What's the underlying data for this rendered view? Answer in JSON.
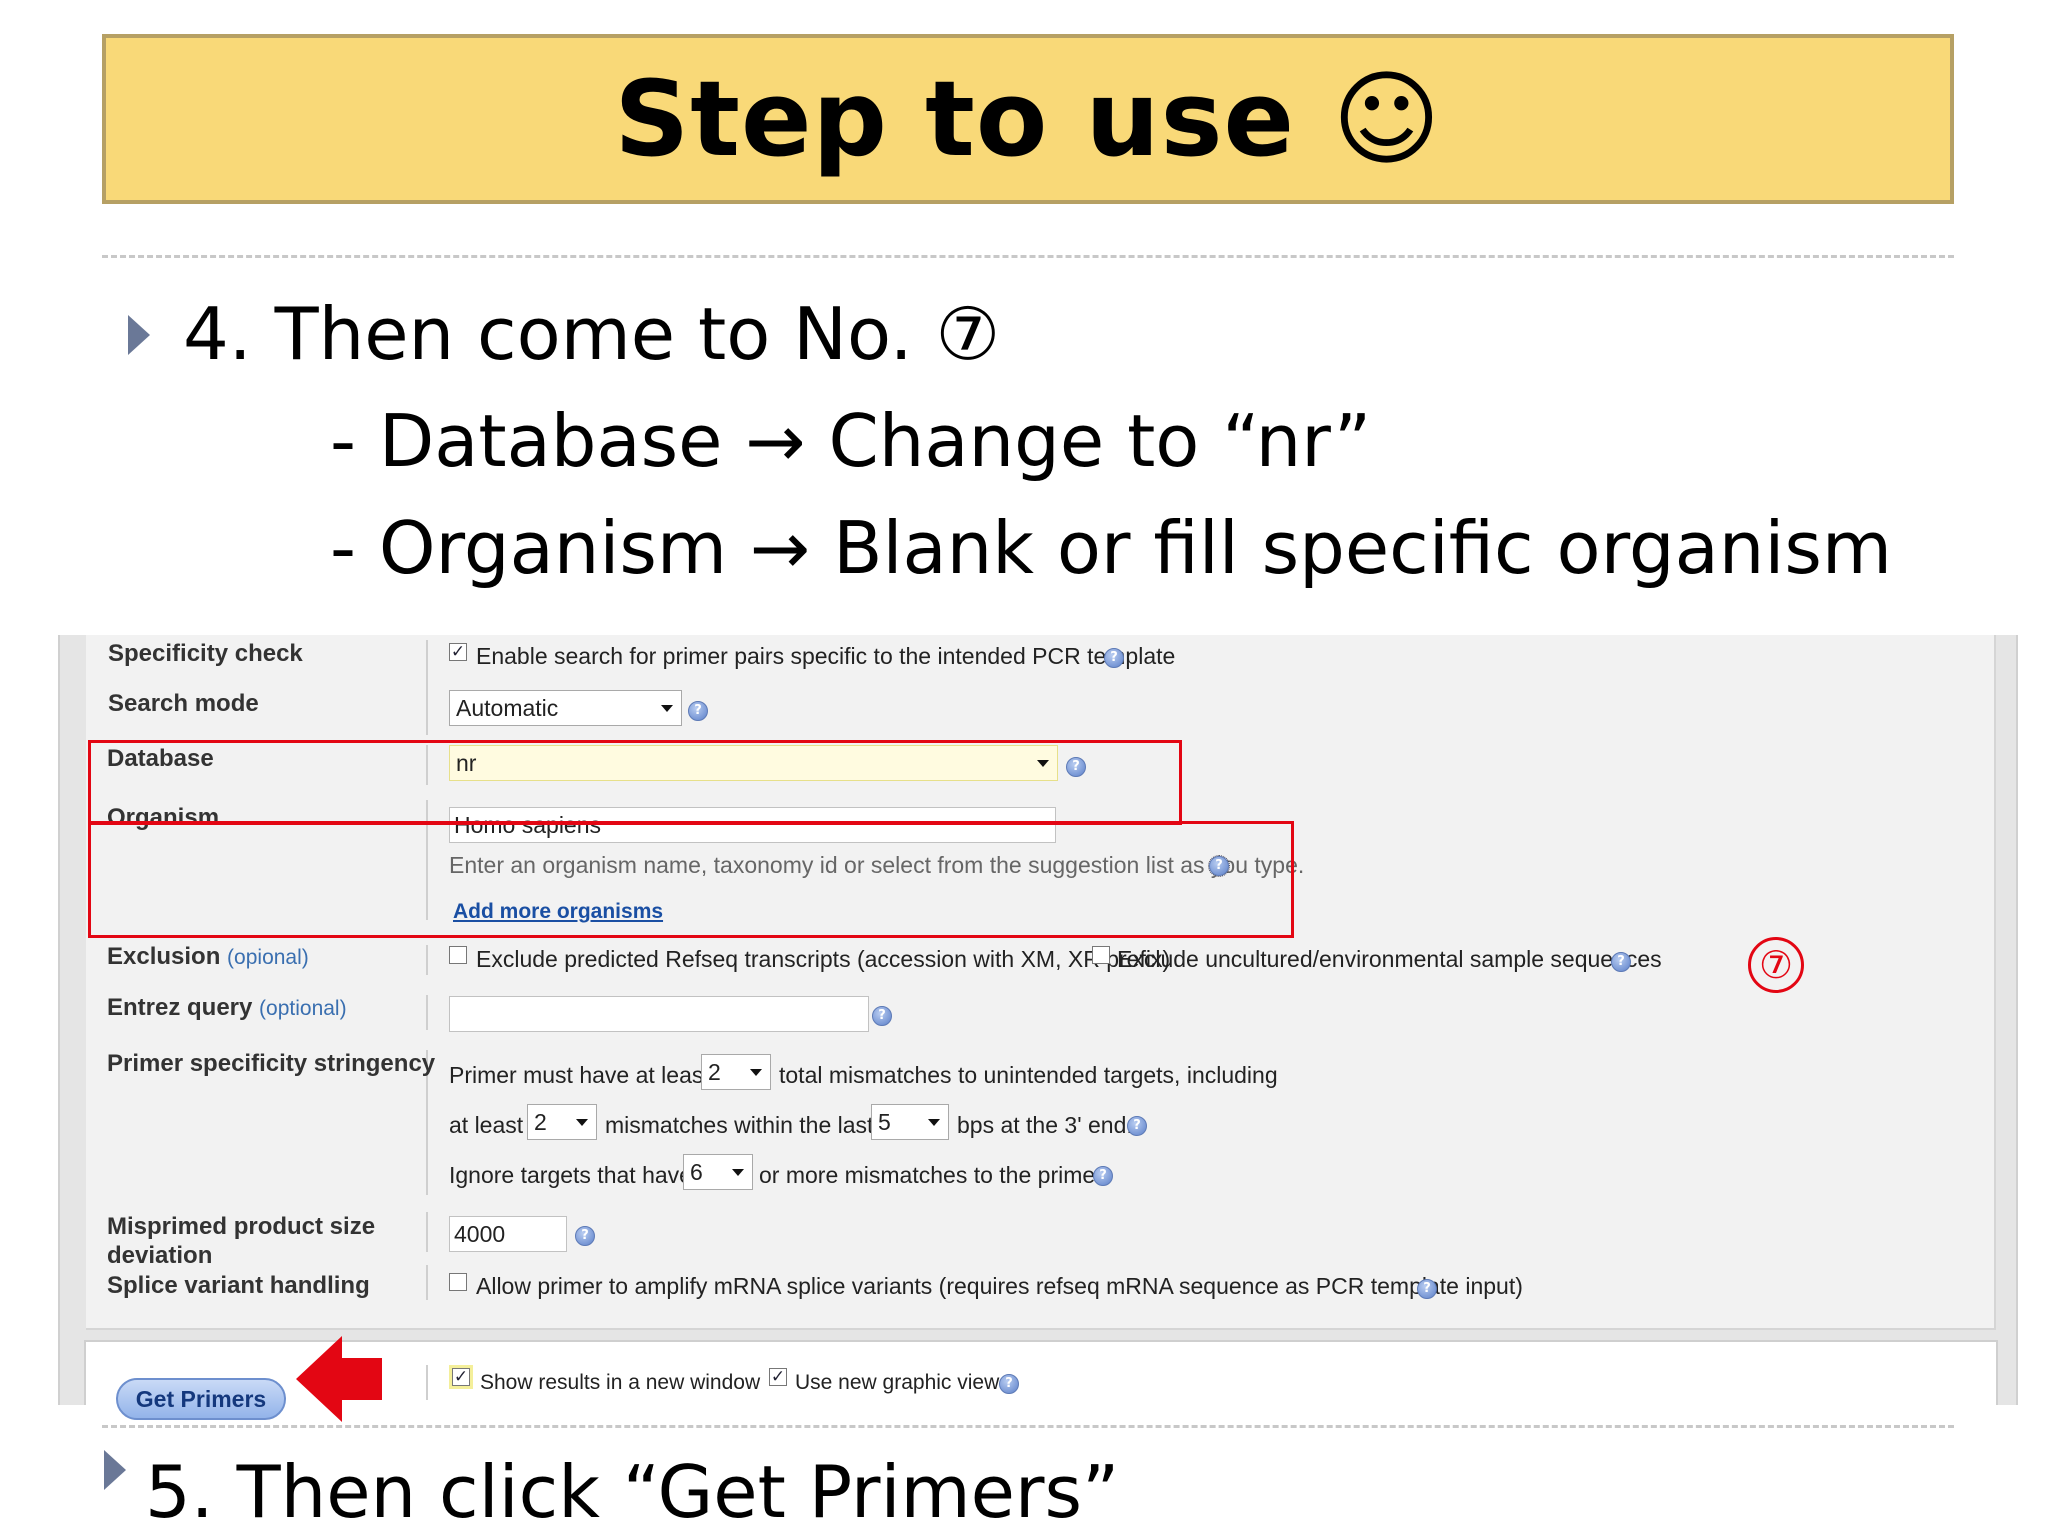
{
  "slide": {
    "title": "Step to use ☺",
    "step4": "4. Then come to No. ⑦",
    "line_database": "- Database → Change to “nr”",
    "line_organism": "- Organism → Blank or fill specific organism",
    "step5": "5. Then click “Get Primers”",
    "marker": "⑦"
  },
  "form": {
    "specificity_check": {
      "label": "Specificity check",
      "checkbox_text": "Enable search for primer pairs specific to the intended PCR template",
      "checked": "✓"
    },
    "search_mode": {
      "label": "Search mode",
      "value": "Automatic"
    },
    "database": {
      "label": "Database",
      "value": "nr"
    },
    "organism": {
      "label": "Organism",
      "value": "Homo sapiens",
      "hint": "Enter an organism name, taxonomy id or select from the suggestion list as you type.",
      "add_link": "Add more organisms"
    },
    "exclusion": {
      "label": "Exclusion",
      "label_note": "(opional)",
      "option1": "Exclude predicted Refseq transcripts (accession with XM, XR prefix)",
      "option2": "Exclude uncultured/environmental sample sequences"
    },
    "entrez_query": {
      "label": "Entrez query",
      "label_note": "(optional)",
      "value": ""
    },
    "primer_stringency": {
      "label": "Primer specificity stringency",
      "row1_pre": "Primer must have at least",
      "row1_val": "2",
      "row1_post": "total mismatches to unintended targets, including",
      "row2_pre": "at least",
      "row2_val": "2",
      "row2_mid": "mismatches within the last",
      "row2_val2": "5",
      "row2_post": "bps at the 3' end.",
      "row3_pre": "Ignore targets that have",
      "row3_val": "6",
      "row3_post": "or more mismatches to the primer."
    },
    "misprimed": {
      "label_line1": "Misprimed product size",
      "label_line2": "deviation",
      "value": "4000"
    },
    "splice": {
      "label": "Splice variant handling",
      "checkbox_text": "Allow primer to amplify mRNA splice variants (requires refseq mRNA sequence as PCR template input)"
    }
  },
  "bottom": {
    "get_primers": "Get Primers",
    "show_new_window": "Show results in a new window",
    "new_graphic_view": "Use new graphic view",
    "checked": "✓"
  },
  "colors": {
    "highlight_red": "#e30613",
    "banner": "#f9d978",
    "bullet": "#6a7897"
  }
}
